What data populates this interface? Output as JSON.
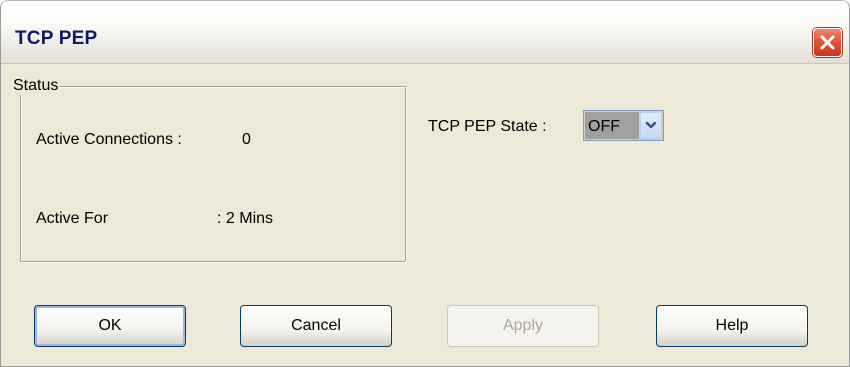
{
  "window": {
    "title": "TCP PEP",
    "close_icon": "close-icon"
  },
  "status": {
    "legend": "Status",
    "active_connections_label": "Active Connections :",
    "active_connections_value": "0",
    "active_for_label": "Active For",
    "active_for_value": ": 2 Mins"
  },
  "tcp_pep_state": {
    "label": "TCP PEP State :",
    "selected": "OFF",
    "arrow_icon": "chevron-down-icon"
  },
  "buttons": {
    "ok": "OK",
    "cancel": "Cancel",
    "apply": "Apply",
    "help": "Help"
  },
  "colors": {
    "title_text": "#0d1a6b",
    "dialog_background": "#ece9d8",
    "close_button": "#e0553a",
    "button_border": "#003c74",
    "disabled_text": "#aca899"
  }
}
